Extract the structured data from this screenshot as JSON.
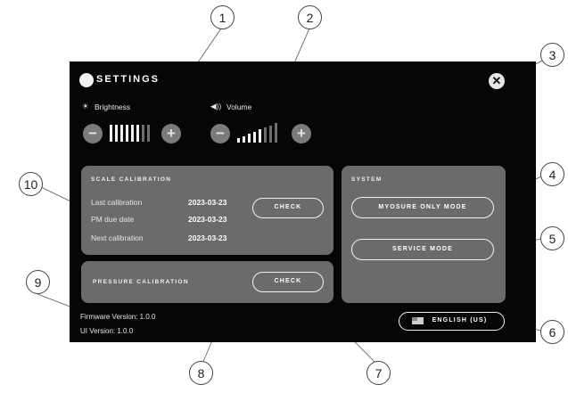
{
  "header": {
    "title": "SETTINGS",
    "close_icon": "close-x-icon"
  },
  "brightness": {
    "label": "Brightness",
    "icon": "sun-icon",
    "level_bars": 6,
    "total_bars": 8,
    "minus": "−",
    "plus": "+"
  },
  "volume": {
    "label": "Volume",
    "icon": "speaker-icon",
    "level_bars": 5,
    "total_bars": 8,
    "minus": "−",
    "plus": "+"
  },
  "scale_calibration": {
    "title": "SCALE CALIBRATION",
    "rows": [
      {
        "label": "Last calibration",
        "value": "2023-03-23"
      },
      {
        "label": "PM due date",
        "value": "2023-03-23"
      },
      {
        "label": "Next calibration",
        "value": "2023-03-23"
      }
    ],
    "check_label": "CHECK"
  },
  "pressure_calibration": {
    "title": "PRESSURE CALIBRATION",
    "check_label": "CHECK"
  },
  "system": {
    "title": "SYSTEM",
    "myosure_label": "MYOSURE ONLY MODE",
    "service_label": "SERVICE MODE"
  },
  "language": {
    "label": "ENGLISH (US)",
    "flag_icon": "us-flag-icon"
  },
  "footer": {
    "firmware": "Firmware Version: 1.0.0",
    "ui": "UI Version: 1.0.0"
  },
  "callouts": [
    "1",
    "2",
    "3",
    "4",
    "5",
    "6",
    "7",
    "8",
    "9",
    "10"
  ],
  "colors": {
    "panel": "#060606",
    "card": "#6b6b6b",
    "button": "#7b7b7b",
    "accent": "#ffffff"
  }
}
